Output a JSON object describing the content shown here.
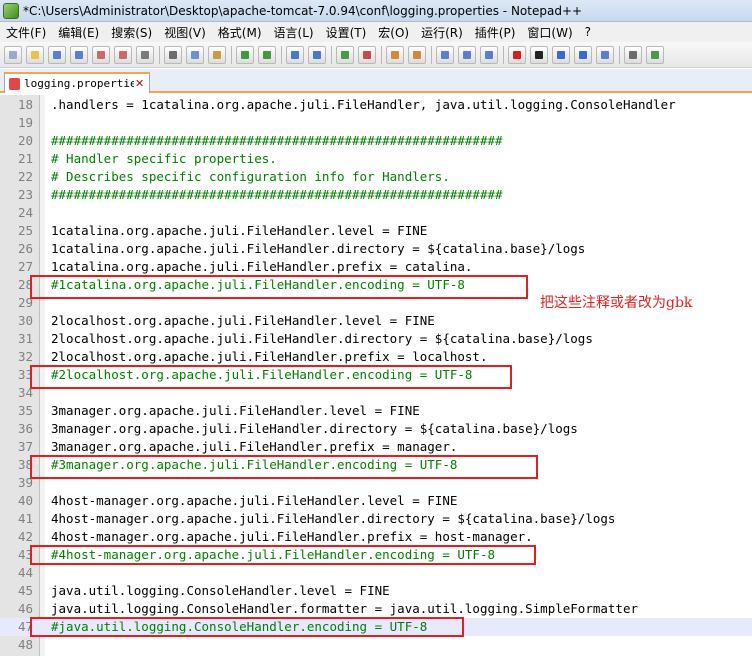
{
  "window": {
    "title": "*C:\\Users\\Administrator\\Desktop\\apache-tomcat-7.0.94\\conf\\logging.properties - Notepad++"
  },
  "menu": [
    "文件(F)",
    "编辑(E)",
    "搜索(S)",
    "视图(V)",
    "格式(M)",
    "语言(L)",
    "设置(T)",
    "宏(O)",
    "运行(R)",
    "插件(P)",
    "窗口(W)",
    "?"
  ],
  "tab": {
    "label": "logging.properties"
  },
  "colors": {
    "comment": "#008000",
    "highlight": "#e02020",
    "tab_accent": "#f4a54d"
  },
  "lines": [
    {
      "num": "18",
      "text": ".handlers = 1catalina.org.apache.juli.FileHandler, java.util.logging.ConsoleHandler",
      "comment": false
    },
    {
      "num": "19",
      "text": "",
      "comment": false
    },
    {
      "num": "20",
      "text": "############################################################",
      "comment": true
    },
    {
      "num": "21",
      "text": "# Handler specific properties.",
      "comment": true
    },
    {
      "num": "22",
      "text": "# Describes specific configuration info for Handlers.",
      "comment": true
    },
    {
      "num": "23",
      "text": "############################################################",
      "comment": true
    },
    {
      "num": "24",
      "text": "",
      "comment": false
    },
    {
      "num": "25",
      "text": "1catalina.org.apache.juli.FileHandler.level = FINE",
      "comment": false
    },
    {
      "num": "26",
      "text": "1catalina.org.apache.juli.FileHandler.directory = ${catalina.base}/logs",
      "comment": false
    },
    {
      "num": "27",
      "text": "1catalina.org.apache.juli.FileHandler.prefix = catalina.",
      "comment": false
    },
    {
      "num": "28",
      "text": "#1catalina.org.apache.juli.FileHandler.encoding = UTF-8",
      "comment": true
    },
    {
      "num": "29",
      "text": "",
      "comment": false
    },
    {
      "num": "30",
      "text": "2localhost.org.apache.juli.FileHandler.level = FINE",
      "comment": false
    },
    {
      "num": "31",
      "text": "2localhost.org.apache.juli.FileHandler.directory = ${catalina.base}/logs",
      "comment": false
    },
    {
      "num": "32",
      "text": "2localhost.org.apache.juli.FileHandler.prefix = localhost.",
      "comment": false
    },
    {
      "num": "33",
      "text": "#2localhost.org.apache.juli.FileHandler.encoding = UTF-8",
      "comment": true
    },
    {
      "num": "34",
      "text": "",
      "comment": false
    },
    {
      "num": "35",
      "text": "3manager.org.apache.juli.FileHandler.level = FINE",
      "comment": false
    },
    {
      "num": "36",
      "text": "3manager.org.apache.juli.FileHandler.directory = ${catalina.base}/logs",
      "comment": false
    },
    {
      "num": "37",
      "text": "3manager.org.apache.juli.FileHandler.prefix = manager.",
      "comment": false
    },
    {
      "num": "38",
      "text": "#3manager.org.apache.juli.FileHandler.encoding = UTF-8",
      "comment": true
    },
    {
      "num": "39",
      "text": "",
      "comment": false
    },
    {
      "num": "40",
      "text": "4host-manager.org.apache.juli.FileHandler.level = FINE",
      "comment": false
    },
    {
      "num": "41",
      "text": "4host-manager.org.apache.juli.FileHandler.directory = ${catalina.base}/logs",
      "comment": false
    },
    {
      "num": "42",
      "text": "4host-manager.org.apache.juli.FileHandler.prefix = host-manager.",
      "comment": false
    },
    {
      "num": "43",
      "text": "#4host-manager.org.apache.juli.FileHandler.encoding = UTF-8",
      "comment": true
    },
    {
      "num": "44",
      "text": "",
      "comment": false
    },
    {
      "num": "45",
      "text": "java.util.logging.ConsoleHandler.level = FINE",
      "comment": false
    },
    {
      "num": "46",
      "text": "java.util.logging.ConsoleHandler.formatter = java.util.logging.SimpleFormatter",
      "comment": false
    },
    {
      "num": "47",
      "text": "#java.util.logging.ConsoleHandler.encoding = UTF-8",
      "comment": true
    },
    {
      "num": "48",
      "text": "",
      "comment": false
    }
  ],
  "current_line": "47",
  "annotation": {
    "text": "把这些注释或者改为gbk"
  }
}
